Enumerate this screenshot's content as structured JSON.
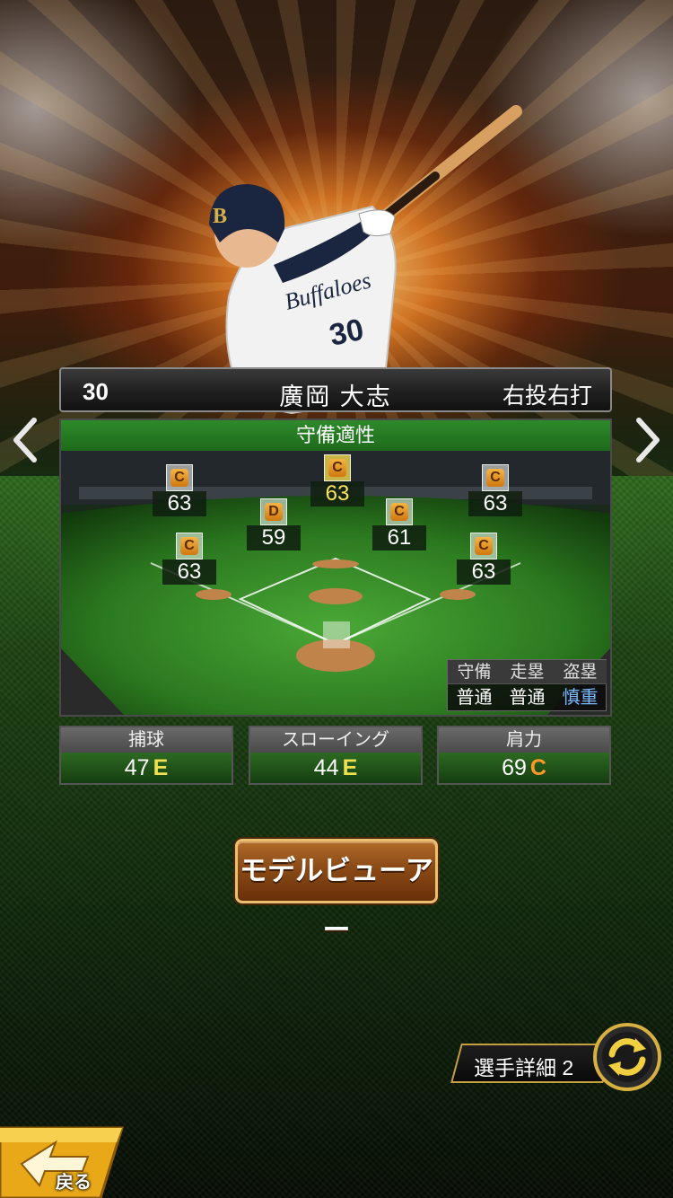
{
  "player": {
    "number": "30",
    "name": "廣岡 大志",
    "handedness": "右投右打"
  },
  "defense": {
    "title": "守備適性",
    "positions": [
      {
        "id": "LF",
        "grade": "C",
        "value": "63"
      },
      {
        "id": "CF",
        "grade": "C",
        "value": "63",
        "main": true
      },
      {
        "id": "RF",
        "grade": "C",
        "value": "63"
      },
      {
        "id": "SS",
        "grade": "D",
        "value": "59"
      },
      {
        "id": "2B",
        "grade": "C",
        "value": "61"
      },
      {
        "id": "3B",
        "grade": "C",
        "value": "63"
      },
      {
        "id": "1B",
        "grade": "C",
        "value": "63"
      }
    ],
    "speed": {
      "headers": [
        "守備",
        "走塁",
        "盗塁"
      ],
      "values": [
        "普通",
        "普通",
        "慎重"
      ]
    }
  },
  "stats": [
    {
      "label": "捕球",
      "value": "47",
      "grade": "E"
    },
    {
      "label": "スローイング",
      "value": "44",
      "grade": "E"
    },
    {
      "label": "肩力",
      "value": "69",
      "grade": "C"
    }
  ],
  "buttons": {
    "model_viewer": "モデルビューアー",
    "player_detail": "選手詳細 2",
    "back": "戻る"
  },
  "colors": {
    "grade_c": "#ff9a2a",
    "grade_e": "#f0e050",
    "accent_gold": "#e8c070",
    "defense_green": "#2e8a2a"
  },
  "icons": {
    "prev": "chevron-left-icon",
    "next": "chevron-right-icon",
    "swap": "swap-icon",
    "back": "back-arrow-icon"
  }
}
